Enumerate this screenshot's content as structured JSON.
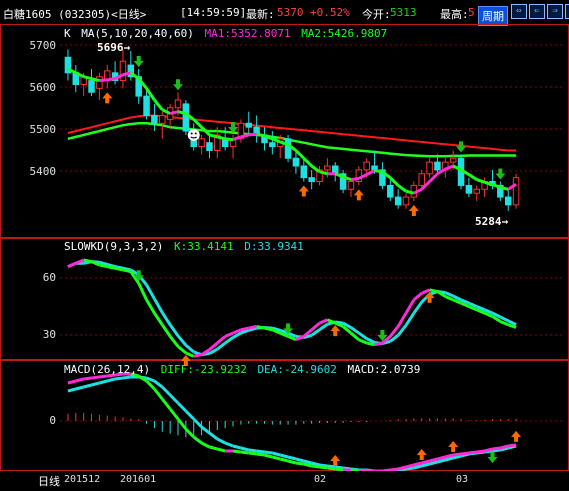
{
  "header": {
    "title": "白糖1605 (032305)<日线>",
    "time": "[14:59:59]",
    "last_label": "最新:",
    "last": "5370",
    "change": "+0.52%",
    "open_label": "今开:",
    "open": "5313",
    "high_label": "最高:",
    "high": "5",
    "period_button": "周期",
    "ctrl_icons": [
      "⇔",
      "⇐",
      "⇒",
      "▣"
    ]
  },
  "main_panel": {
    "legend_k": "K",
    "legend_ma": "MA(5,10,20,40,60)",
    "ma1": "MA1:5352.8071",
    "ma2": "MA2:5426.9807",
    "y_ticks": [
      "5700",
      "5600",
      "5500",
      "5400"
    ],
    "high_note": "5696→",
    "low_note": "5284→"
  },
  "kd_panel": {
    "legend": "SLOWKD(9,3,3,2)",
    "k": "K:33.4141",
    "d": "D:33.9341",
    "y_ticks": [
      "60",
      "30"
    ]
  },
  "macd_panel": {
    "legend": "MACD(26,12,4)",
    "diff": "DIFF:-23.9232",
    "dea": "DEA:-24.9602",
    "macd": "MACD:2.0739",
    "y_ticks": [
      "0"
    ]
  },
  "x_axis": {
    "period_label": "日线",
    "labels": [
      "201512",
      "201601",
      "02",
      "03"
    ]
  },
  "colors": {
    "up": "#ff3030",
    "down": "#1ee0e0",
    "ma1": "#ff2bd6",
    "ma2": "#19ff19",
    "ma_long": "#ff1a1a",
    "ma_mid": "#20ff20",
    "grid": "#8a0000"
  },
  "chart_data": {
    "type": "candlestick",
    "ylim": [
      5230,
      5740
    ],
    "bars": [
      [
        5680,
        5700,
        5620,
        5640
      ],
      [
        5640,
        5660,
        5590,
        5610
      ],
      [
        5610,
        5640,
        5580,
        5630
      ],
      [
        5620,
        5650,
        5580,
        5590
      ],
      [
        5600,
        5640,
        5570,
        5630
      ],
      [
        5620,
        5660,
        5600,
        5645
      ],
      [
        5640,
        5670,
        5610,
        5620
      ],
      [
        5620,
        5700,
        5600,
        5670
      ],
      [
        5660,
        5696,
        5620,
        5630
      ],
      [
        5630,
        5650,
        5560,
        5580
      ],
      [
        5580,
        5600,
        5520,
        5530
      ],
      [
        5530,
        5560,
        5490,
        5510
      ],
      [
        5510,
        5540,
        5470,
        5530
      ],
      [
        5520,
        5560,
        5500,
        5550
      ],
      [
        5550,
        5590,
        5530,
        5570
      ],
      [
        5560,
        5570,
        5480,
        5490
      ],
      [
        5490,
        5510,
        5440,
        5450
      ],
      [
        5450,
        5480,
        5430,
        5470
      ],
      [
        5460,
        5480,
        5420,
        5440
      ],
      [
        5440,
        5500,
        5420,
        5480
      ],
      [
        5470,
        5500,
        5440,
        5450
      ],
      [
        5450,
        5480,
        5420,
        5470
      ],
      [
        5470,
        5520,
        5460,
        5510
      ],
      [
        5510,
        5540,
        5480,
        5500
      ],
      [
        5500,
        5530,
        5460,
        5480
      ],
      [
        5480,
        5500,
        5440,
        5460
      ],
      [
        5460,
        5490,
        5430,
        5450
      ],
      [
        5450,
        5480,
        5420,
        5470
      ],
      [
        5470,
        5480,
        5410,
        5420
      ],
      [
        5420,
        5440,
        5380,
        5400
      ],
      [
        5400,
        5420,
        5360,
        5370
      ],
      [
        5370,
        5390,
        5340,
        5360
      ],
      [
        5360,
        5400,
        5350,
        5390
      ],
      [
        5390,
        5420,
        5370,
        5400
      ],
      [
        5400,
        5410,
        5360,
        5380
      ],
      [
        5380,
        5390,
        5330,
        5340
      ],
      [
        5340,
        5370,
        5320,
        5360
      ],
      [
        5360,
        5400,
        5350,
        5390
      ],
      [
        5390,
        5420,
        5370,
        5410
      ],
      [
        5400,
        5440,
        5380,
        5390
      ],
      [
        5390,
        5410,
        5340,
        5350
      ],
      [
        5350,
        5370,
        5310,
        5320
      ],
      [
        5320,
        5340,
        5290,
        5300
      ],
      [
        5300,
        5330,
        5290,
        5320
      ],
      [
        5320,
        5360,
        5310,
        5350
      ],
      [
        5350,
        5390,
        5340,
        5380
      ],
      [
        5380,
        5420,
        5370,
        5410
      ],
      [
        5410,
        5430,
        5380,
        5390
      ],
      [
        5390,
        5420,
        5370,
        5410
      ],
      [
        5410,
        5440,
        5390,
        5420
      ],
      [
        5420,
        5430,
        5340,
        5350
      ],
      [
        5350,
        5370,
        5320,
        5330
      ],
      [
        5330,
        5350,
        5310,
        5340
      ],
      [
        5340,
        5370,
        5320,
        5360
      ],
      [
        5360,
        5390,
        5340,
        5350
      ],
      [
        5350,
        5360,
        5310,
        5320
      ],
      [
        5320,
        5340,
        5284,
        5300
      ],
      [
        5300,
        5380,
        5290,
        5370
      ]
    ],
    "ma1": [
      5650,
      5640,
      5630,
      5625,
      5620,
      5622,
      5625,
      5635,
      5640,
      5625,
      5600,
      5570,
      5545,
      5535,
      5540,
      5535,
      5520,
      5500,
      5480,
      5475,
      5470,
      5468,
      5475,
      5480,
      5482,
      5478,
      5470,
      5462,
      5455,
      5440,
      5420,
      5400,
      5385,
      5380,
      5380,
      5372,
      5365,
      5368,
      5378,
      5388,
      5385,
      5370,
      5350,
      5335,
      5330,
      5340,
      5360,
      5380,
      5392,
      5400,
      5390,
      5378,
      5365,
      5358,
      5352,
      5345,
      5340,
      5353
    ],
    "ma2": [
      5470,
      5475,
      5480,
      5485,
      5490,
      5495,
      5500,
      5505,
      5508,
      5510,
      5510,
      5508,
      5505,
      5500,
      5498,
      5496,
      5494,
      5492,
      5490,
      5490,
      5488,
      5486,
      5484,
      5482,
      5480,
      5478,
      5475,
      5472,
      5468,
      5464,
      5460,
      5456,
      5452,
      5448,
      5446,
      5444,
      5442,
      5440,
      5438,
      5436,
      5434,
      5432,
      5430,
      5428,
      5427,
      5426,
      5425,
      5425,
      5425,
      5426,
      5426,
      5427,
      5427,
      5427,
      5427,
      5427,
      5427,
      5427
    ],
    "ma_long": [
      5485,
      5490,
      5495,
      5500,
      5505,
      5510,
      5515,
      5520,
      5525,
      5528,
      5530,
      5530,
      5528,
      5526,
      5524,
      5522,
      5520,
      5518,
      5516,
      5514,
      5512,
      5510,
      5508,
      5506,
      5504,
      5502,
      5500,
      5498,
      5496,
      5494,
      5492,
      5490,
      5488,
      5486,
      5484,
      5482,
      5480,
      5478,
      5476,
      5474,
      5472,
      5470,
      5468,
      5466,
      5464,
      5462,
      5460,
      5458,
      5456,
      5454,
      5452,
      5450,
      5448,
      5446,
      5444,
      5442,
      5440,
      5440
    ],
    "kd": [
      70,
      72,
      74,
      73,
      71,
      70,
      69,
      68,
      67,
      60,
      50,
      42,
      35,
      28,
      22,
      18,
      16,
      17,
      20,
      24,
      28,
      30,
      32,
      33,
      34,
      33,
      32,
      30,
      28,
      26,
      28,
      32,
      36,
      38,
      36,
      34,
      30,
      26,
      24,
      23,
      24,
      28,
      34,
      42,
      50,
      54,
      56,
      55,
      52,
      50,
      48,
      46,
      44,
      42,
      40,
      37,
      35,
      33.4
    ],
    "macd_diff": [
      38,
      40,
      42,
      43,
      44,
      45,
      46,
      47,
      47,
      45,
      40,
      32,
      22,
      12,
      2,
      -8,
      -16,
      -22,
      -26,
      -28,
      -30,
      -30,
      -31,
      -32,
      -33,
      -34,
      -36,
      -38,
      -40,
      -42,
      -43,
      -45,
      -46,
      -47,
      -48,
      -49,
      -49,
      -50,
      -50,
      -50,
      -50,
      -49,
      -48,
      -46,
      -44,
      -42,
      -40,
      -38,
      -36,
      -34,
      -33,
      -32,
      -31,
      -30,
      -28,
      -27,
      -25,
      -23.9
    ],
    "macd_dea": [
      30,
      32,
      34,
      36,
      38,
      40,
      42,
      43,
      44,
      44,
      43,
      40,
      34,
      26,
      18,
      10,
      2,
      -6,
      -12,
      -18,
      -22,
      -25,
      -27,
      -29,
      -30,
      -31,
      -32,
      -34,
      -36,
      -38,
      -40,
      -42,
      -44,
      -45,
      -46,
      -47,
      -48,
      -49,
      -49,
      -50,
      -50,
      -50,
      -49,
      -48,
      -47,
      -45,
      -43,
      -41,
      -39,
      -37,
      -35,
      -33,
      -32,
      -31,
      -30,
      -29,
      -27,
      -25
    ],
    "macd_hist": [
      8,
      9,
      9,
      8,
      7,
      6,
      5,
      4,
      3,
      2,
      -3,
      -8,
      -12,
      -14,
      -16,
      -18,
      -18,
      -16,
      -14,
      -10,
      -8,
      -6,
      -4,
      -3,
      -3,
      -3,
      -4,
      -4,
      -4,
      -4,
      -3,
      -3,
      -2,
      -2,
      -2,
      -2,
      -1,
      -1,
      -1,
      0,
      0,
      1,
      2,
      2,
      3,
      3,
      3,
      3,
      3,
      3,
      2,
      1,
      1,
      1,
      2,
      2,
      2,
      2
    ]
  }
}
